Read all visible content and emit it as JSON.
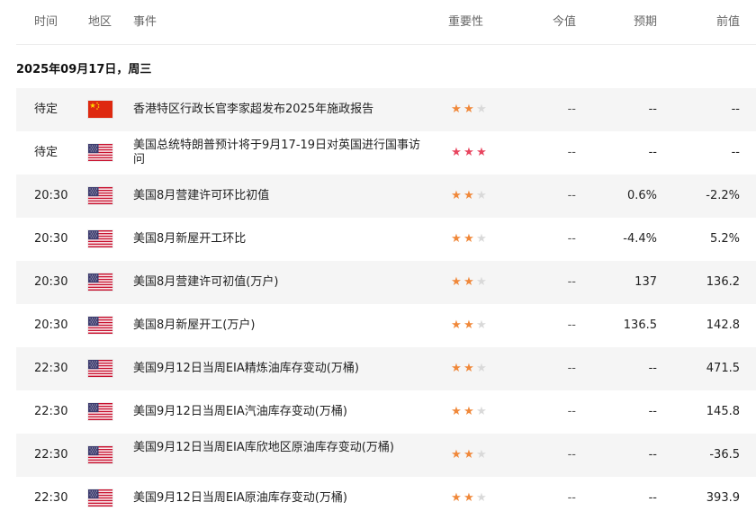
{
  "header": {
    "time": "时间",
    "region": "地区",
    "event": "事件",
    "importance": "重要性",
    "actual": "今值",
    "forecast": "预期",
    "previous": "前值"
  },
  "date_label": "2025年09月17日，周三",
  "colors": {
    "star_orange": "#f0883a",
    "star_red": "#e8455f",
    "star_empty": "#d9d9d9",
    "row_alt_bg": "#f5f5f5"
  },
  "rows": [
    {
      "time": "待定",
      "flag": "china-flag-icon",
      "event": "香港特区行政长官李家超发布2025年施政报告",
      "stars": 2,
      "actual": "--",
      "forecast": "--",
      "previous": "--"
    },
    {
      "time": "待定",
      "flag": "usa-flag-icon",
      "event": "美国总统特朗普预计将于9月17-19日对英国进行国事访问",
      "stars": 3,
      "actual": "--",
      "forecast": "--",
      "previous": "--"
    },
    {
      "time": "20:30",
      "flag": "usa-flag-icon",
      "event": "美国8月营建许可环比初值",
      "stars": 2,
      "actual": "--",
      "forecast": "0.6%",
      "previous": "-2.2%"
    },
    {
      "time": "20:30",
      "flag": "usa-flag-icon",
      "event": "美国8月新屋开工环比",
      "stars": 2,
      "actual": "--",
      "forecast": "-4.4%",
      "previous": "5.2%"
    },
    {
      "time": "20:30",
      "flag": "usa-flag-icon",
      "event": "美国8月营建许可初值(万户)",
      "stars": 2,
      "actual": "--",
      "forecast": "137",
      "previous": "136.2"
    },
    {
      "time": "20:30",
      "flag": "usa-flag-icon",
      "event": "美国8月新屋开工(万户)",
      "stars": 2,
      "actual": "--",
      "forecast": "136.5",
      "previous": "142.8"
    },
    {
      "time": "22:30",
      "flag": "usa-flag-icon",
      "event": "美国9月12日当周EIA精炼油库存变动(万桶)",
      "stars": 2,
      "actual": "--",
      "forecast": "--",
      "previous": "471.5"
    },
    {
      "time": "22:30",
      "flag": "usa-flag-icon",
      "event": "美国9月12日当周EIA汽油库存变动(万桶)",
      "stars": 2,
      "actual": "--",
      "forecast": "--",
      "previous": "145.8"
    },
    {
      "time": "22:30",
      "flag": "usa-flag-icon",
      "event": "美国9月12日当周EIA库欣地区原油库存变动(万桶)",
      "stars": 2,
      "actual": "--",
      "forecast": "--",
      "previous": "-36.5"
    },
    {
      "time": "22:30",
      "flag": "usa-flag-icon",
      "event": "美国9月12日当周EIA原油库存变动(万桶)",
      "stars": 2,
      "actual": "--",
      "forecast": "--",
      "previous": "393.9"
    }
  ]
}
